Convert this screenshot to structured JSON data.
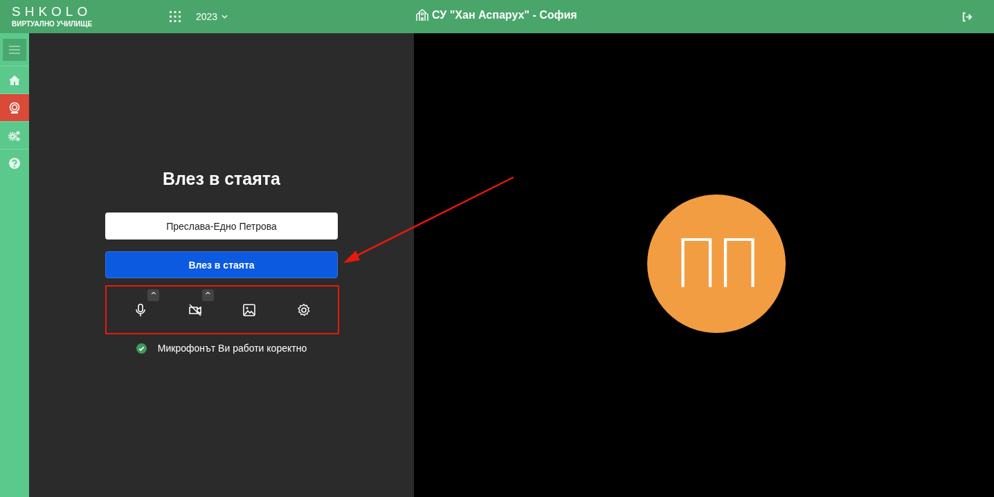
{
  "header": {
    "logo": "SHKOLO",
    "logo_subtitle": "ВИРТУАЛНО УЧИЛИЩЕ",
    "year": "2023",
    "school": "СУ \"Хан Аспарух\" - София"
  },
  "sidebar": {
    "items": [
      {
        "kind": "home",
        "selected": false
      },
      {
        "kind": "webcam",
        "selected": true
      },
      {
        "kind": "gears",
        "selected": false
      },
      {
        "kind": "help",
        "selected": false
      }
    ]
  },
  "join": {
    "title": "Влез в стаята",
    "name_value": "Преслава-Едно Петрова",
    "join_button": "Влез в стаята",
    "devices": [
      {
        "kind": "microphone",
        "on": true,
        "menu_glyph": "^"
      },
      {
        "kind": "camera",
        "on": false,
        "menu_glyph": "^"
      },
      {
        "kind": "background"
      },
      {
        "kind": "settings"
      }
    ],
    "status": {
      "ok": true,
      "text": "Микрофонът Ви работи коректно"
    }
  },
  "preview": {
    "initials": "ПП"
  }
}
